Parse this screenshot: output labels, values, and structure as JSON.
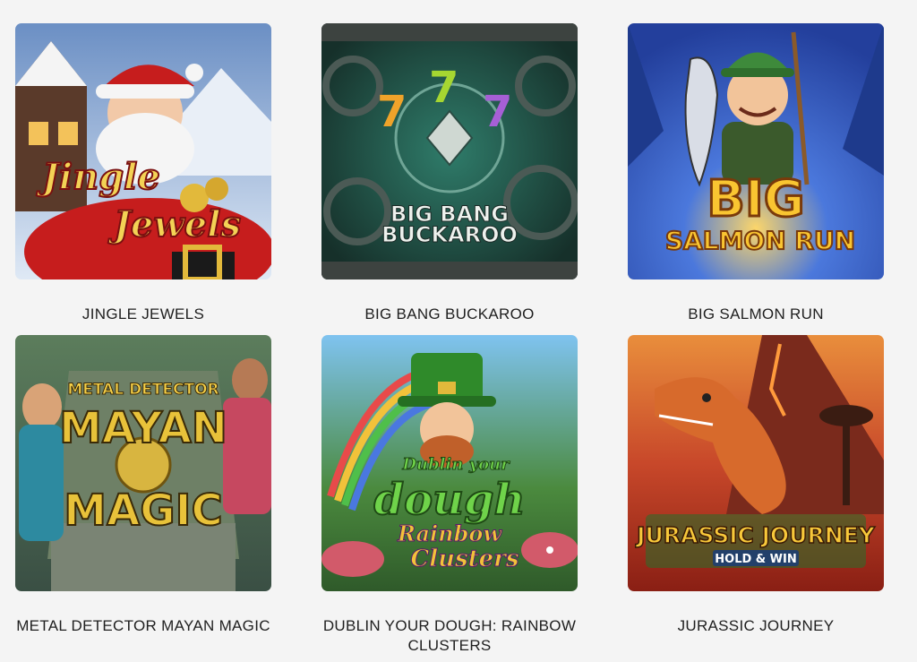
{
  "games": [
    {
      "title": "JINGLE JEWELS",
      "logo_line1": "Jingle",
      "logo_line2": "Jewels"
    },
    {
      "title": "BIG BANG BUCKAROO",
      "logo_line1": "BIG BANG",
      "logo_line2": "BUCKAROO",
      "reels": [
        "7",
        "7",
        "7"
      ]
    },
    {
      "title": "BIG SALMON RUN",
      "logo_line1": "BIG",
      "logo_line2": "SALMON RUN"
    },
    {
      "title": "METAL DETECTOR MAYAN MAGIC",
      "logo_line1": "METAL DETECTOR",
      "logo_line2": "MAYAN",
      "logo_line3": "MAGIC"
    },
    {
      "title": "DUBLIN YOUR DOUGH: RAINBOW CLUSTERS",
      "logo_line1": "Dublin your",
      "logo_line2": "dough",
      "logo_line3": "Rainbow",
      "logo_line4": "Clusters"
    },
    {
      "title": "JURASSIC JOURNEY",
      "logo_line1": "JURASSIC JOURNEY",
      "logo_line2": "HOLD & WIN"
    }
  ]
}
